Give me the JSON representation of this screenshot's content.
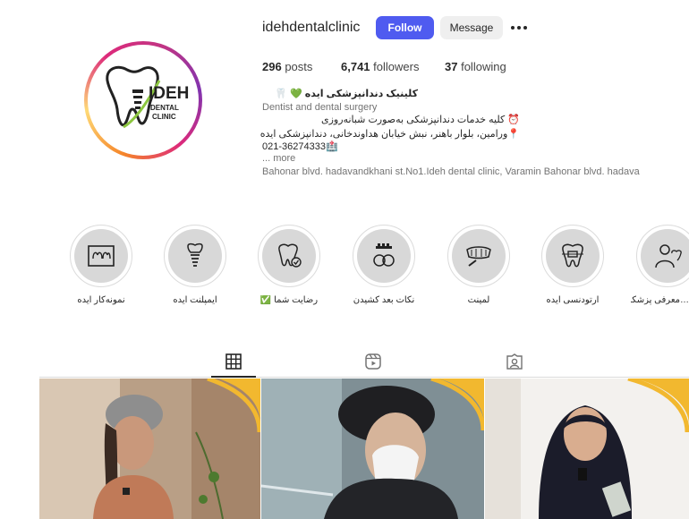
{
  "profile": {
    "username": "idehdentalclinic",
    "follow_label": "Follow",
    "message_label": "Message",
    "logo_text_main": "IDEH",
    "logo_text_sub1": "DENTAL",
    "logo_text_sub2": "CLINIC"
  },
  "stats": {
    "posts_count": "296",
    "posts_label": "posts",
    "followers_count": "6,741",
    "followers_label": "followers",
    "following_count": "37",
    "following_label": "following"
  },
  "bio": {
    "name": "کلینیک دندانپزشکی ایده 💚 🦷",
    "category": "Dentist and dental surgery",
    "line1": "⏰ کلیه خدمات دندانپزشکی به‌صورت شبانه‌روزی",
    "line2": "📍ورامین، بلوار باهنر، نبش خیابان هداوندخانی، دندانپزشکی ایده",
    "phone": "021-36274333🏥",
    "more": "... more",
    "address": "Bahonar blvd. hadavandkhani st.No1.Ideh dental clinic, Varamin Bahonar blvd. hadava"
  },
  "highlights": [
    {
      "label": "نمونه‌کار ایده",
      "icon": "xray-icon"
    },
    {
      "label": "ایمپلنت ایده",
      "icon": "implant-icon"
    },
    {
      "label": "رضایت شما ✅",
      "icon": "tooth-check-icon"
    },
    {
      "label": "نکات بعد کشیدن",
      "icon": "toothbrush-icon"
    },
    {
      "label": "لمینت",
      "icon": "veneer-icon"
    },
    {
      "label": "ارتودنسی ایده",
      "icon": "braces-icon"
    },
    {
      "label": "…معرفی پزشکان",
      "icon": "dentist-icon"
    }
  ],
  "tabs": [
    {
      "name": "posts",
      "icon": "grid-icon",
      "active": true
    },
    {
      "name": "reels",
      "icon": "reels-icon",
      "active": false
    },
    {
      "name": "tagged",
      "icon": "tagged-icon",
      "active": false
    }
  ],
  "colors": {
    "follow_bg": "#4f5bf0",
    "accent_yellow": "#f2b82f",
    "logo_green": "#8cc63f"
  }
}
